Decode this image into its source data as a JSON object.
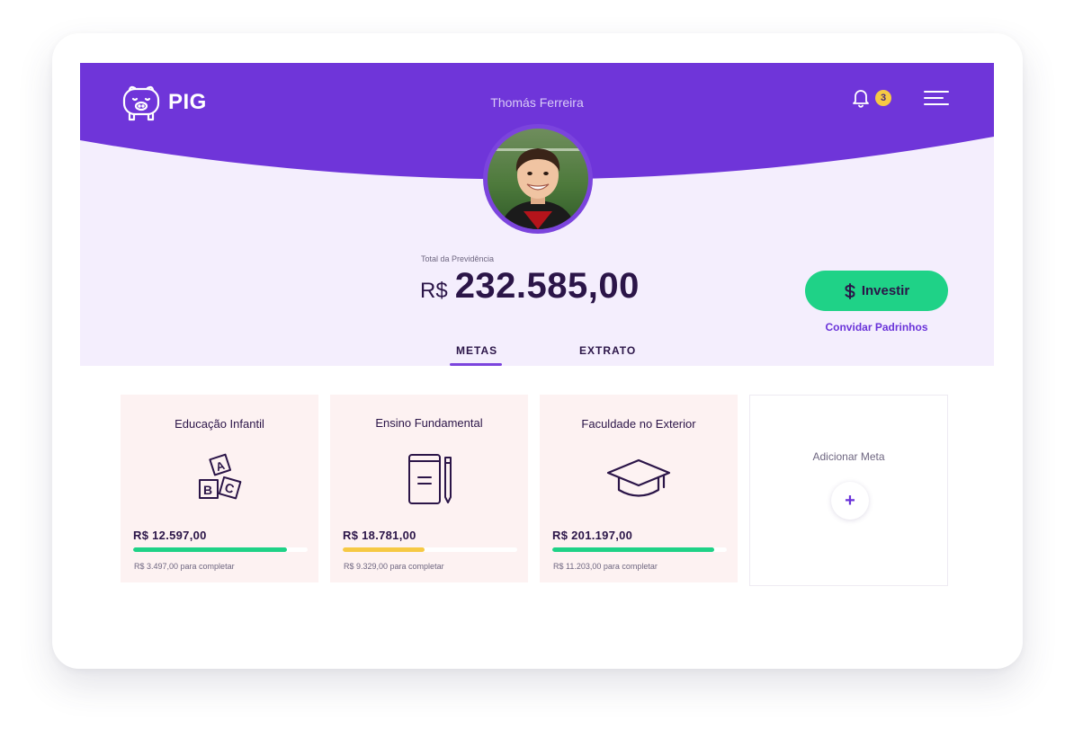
{
  "app": {
    "logo_text": "PIG",
    "logo_icon": "piggy-bank-icon"
  },
  "header": {
    "user_name": "Thomás Ferreira",
    "notifications_count": "3",
    "bell_icon": "bell-icon",
    "menu_icon": "hamburger-menu-icon"
  },
  "colors": {
    "brand_purple": "#6f35d9",
    "accent_green": "#1fd287",
    "accent_yellow": "#f6c944",
    "text_dark": "#2b1548",
    "hero_bg": "#f4eefd",
    "card_bg": "#fdf2f2"
  },
  "balance": {
    "label": "Total da Previdência",
    "currency": "R$",
    "amount": "232.585,00"
  },
  "actions": {
    "invest_label": "Investir",
    "invest_icon": "dollar-icon",
    "invite_label": "Convidar Padrinhos"
  },
  "tabs": [
    {
      "label": "METAS",
      "active": true
    },
    {
      "label": "EXTRATO",
      "active": false
    }
  ],
  "goals": [
    {
      "title": "Educação Infantil",
      "icon": "abc-blocks-icon",
      "amount": "R$ 12.597,00",
      "progress": 0.88,
      "bar_color": "#1fd287",
      "remaining": "R$ 3.497,00 para completar"
    },
    {
      "title": "Ensino Fundamental",
      "icon": "notebook-pencil-icon",
      "amount": "R$ 18.781,00",
      "progress": 0.47,
      "bar_color": "#f6c944",
      "remaining": "R$ 9.329,00 para completar"
    },
    {
      "title": "Faculdade no Exterior",
      "icon": "graduation-cap-icon",
      "amount": "R$ 201.197,00",
      "progress": 0.93,
      "bar_color": "#1fd287",
      "remaining": "R$ 11.203,00 para completar"
    }
  ],
  "add_goal": {
    "label": "Adicionar Meta",
    "button_symbol": "+"
  }
}
